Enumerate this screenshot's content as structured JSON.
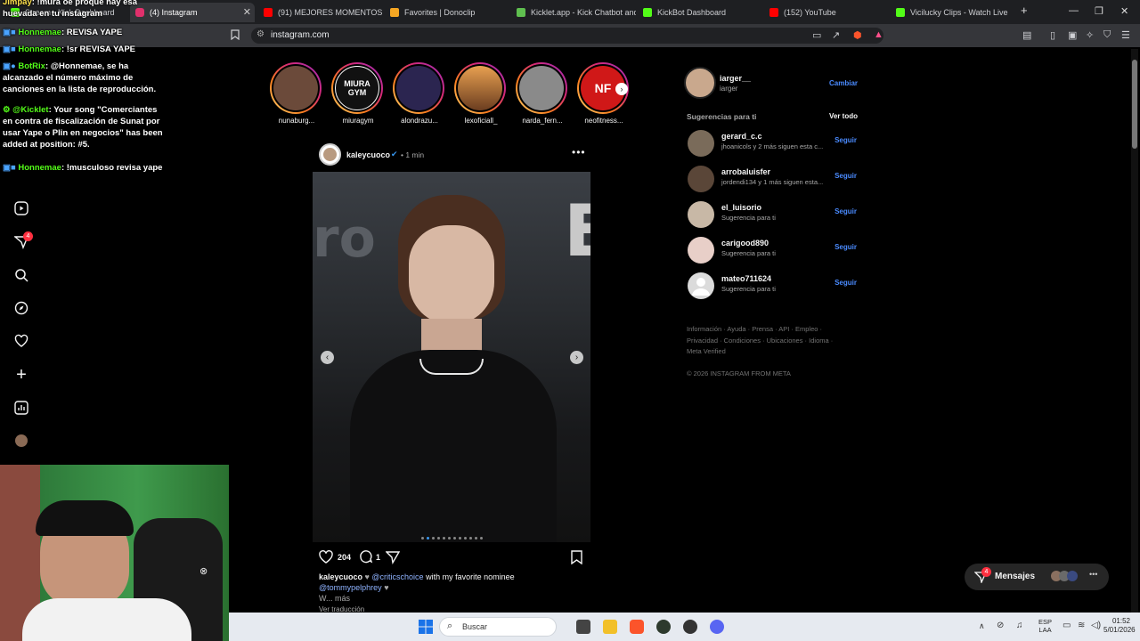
{
  "browser": {
    "tabs": [
      {
        "title": "Stream - Kick Dashboard",
        "favicon_color": "#53fc18",
        "active": false
      },
      {
        "title": "(4) Instagram",
        "favicon_color": "#e1306c",
        "active": true
      },
      {
        "title": "(91) MEJORES MOMENTOS KICK",
        "favicon_color": "#ff0000",
        "active": false
      },
      {
        "title": "Favorites | Donoclip",
        "favicon_color": "#f5a623",
        "active": false
      },
      {
        "title": "Kicklet.app - Kick Chatbot and",
        "favicon_color": "#5fbf4f",
        "active": false
      },
      {
        "title": "KickBot Dashboard",
        "favicon_color": "#53fc18",
        "active": false
      },
      {
        "title": "(152) YouTube",
        "favicon_color": "#ff0000",
        "active": false
      },
      {
        "title": "Vicilucky Clips - Watch Live on",
        "favicon_color": "#53fc18",
        "active": false
      }
    ],
    "new_tab": "+",
    "url": "instagram.com"
  },
  "chat": {
    "messages": [
      {
        "user": "Jimpay",
        "text": ": !mura oe proque hay esa huevada en tu instagram",
        "color": "#ffe14d"
      },
      {
        "user": "Honnemae",
        "text": ": REVISA YAPE",
        "color": "#53fc18"
      },
      {
        "user": "Honnemae",
        "text": ": !sr REVISA YAPE",
        "color": "#53fc18"
      },
      {
        "user": "BotRix",
        "text": ": @Honnemae, se ha alcanzado el número máximo de canciones en la lista de reproducción.",
        "color": "#53fc18"
      },
      {
        "user": "@Kicklet",
        "text": ": Your song \"Comerciantes en contra de fiscalización de Sunat por usar Yape o Plin en negocios\" has been added at position: #5.",
        "color": "#53fc18"
      },
      {
        "user": "Honnemae",
        "text": ": !musculoso revisa yape",
        "color": "#53fc18"
      }
    ]
  },
  "nav": {
    "notifications_badge": "4"
  },
  "stories": [
    {
      "name": "nunaburg...",
      "color": "#6b4a3a",
      "initials": ""
    },
    {
      "name": "miuragym",
      "color": "#111111",
      "initials": "MIURA GYM"
    },
    {
      "name": "alondrazu...",
      "color": "#2b2550",
      "initials": ""
    },
    {
      "name": "lexoficiall_",
      "color": "#c7782e",
      "initials": ""
    },
    {
      "name": "narda_fern...",
      "color": "#8a8a8a",
      "initials": ""
    },
    {
      "name": "neofitness...",
      "color": "#d01818",
      "initials": "NF"
    }
  ],
  "post": {
    "username": "kaleycuoco",
    "time": "1 min",
    "likes": "204",
    "comments": "1",
    "caption_user": "kaleycuoco",
    "caption_mention": "@criticschoice",
    "caption_text": "with my favorite nominee",
    "caption_mention2": "@tommypelphrey",
    "caption_more": "W... más",
    "see_translation": "Ver traducción",
    "carousel_dots": 12,
    "active_dot": 1,
    "image_text_1": "ro",
    "image_text_2": "E"
  },
  "profile": {
    "username": "iarger__",
    "name": "iarger",
    "switch_label": "Cambiar"
  },
  "suggestions": {
    "title": "Sugerencias para ti",
    "see_all": "Ver todo",
    "items": [
      {
        "name": "gerard_c.c",
        "sub": "jhoanicols y 2 más siguen esta c...",
        "color": "#7a6b5a",
        "action": "Seguir"
      },
      {
        "name": "arrobaluisfer",
        "sub": "jordendi134 y 1 más siguen esta...",
        "color": "#5a4638",
        "action": "Seguir"
      },
      {
        "name": "el_luisorio",
        "sub": "Sugerencia para ti",
        "color": "#c8b8a6",
        "action": "Seguir"
      },
      {
        "name": "carigood890",
        "sub": "Sugerencia para ti",
        "color": "#e8cfc8",
        "action": "Seguir"
      },
      {
        "name": "mateo711624",
        "sub": "Sugerencia para ti",
        "color": "#dbdbdb",
        "action": "Seguir"
      }
    ]
  },
  "footer": {
    "links_line1": "Información · Ayuda · Prensa · API · Empleo ·",
    "links_line2": "Privacidad · Condiciones · Ubicaciones · Idioma ·",
    "links_line3": "Meta Verified",
    "copyright": "© 2026 INSTAGRAM FROM META"
  },
  "messages_button": {
    "label": "Mensajes",
    "badge": "4"
  },
  "taskbar": {
    "search_placeholder": "Buscar",
    "lang_1": "ESP",
    "lang_2": "LAA",
    "time": "01:52",
    "date": "5/01/2026"
  },
  "colors": {
    "accent_blue": "#4a8bff",
    "like_red": "#ff3040",
    "kick_green": "#53fc18"
  }
}
